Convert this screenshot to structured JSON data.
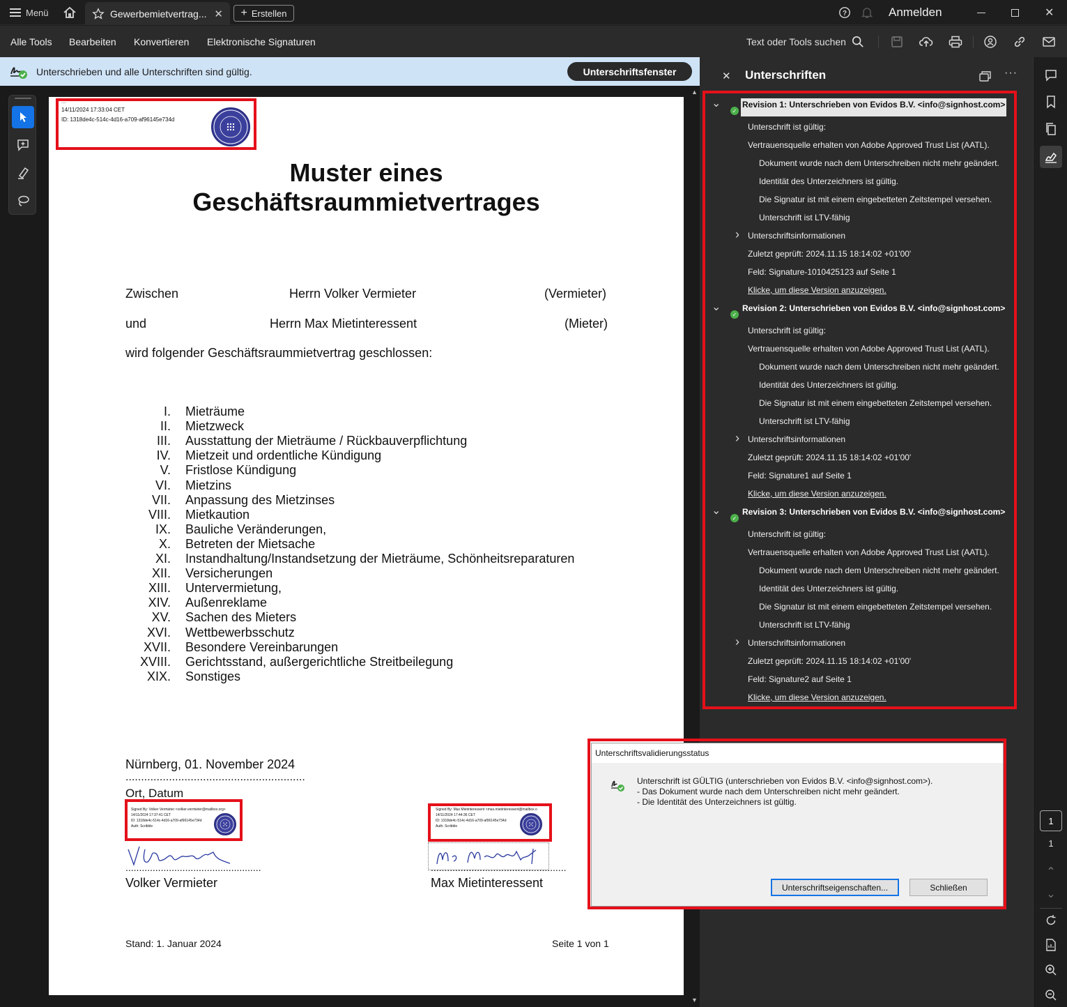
{
  "titlebar": {
    "menu_label": "Menü",
    "tab_title": "Gewerbemietvertrag...",
    "create_label": "Erstellen",
    "signin_label": "Anmelden"
  },
  "menubar": {
    "items": [
      "Alle Tools",
      "Bearbeiten",
      "Konvertieren",
      "Elektronische Signaturen"
    ],
    "search_label": "Text oder Tools suchen"
  },
  "notification": {
    "message": "Unterschrieben und alle Unterschriften sind gültig.",
    "button": "Unterschriftsfenster"
  },
  "document": {
    "top_stamp": {
      "line0": "...",
      "line1": "14/11/2024 17:33:04 CET",
      "line2": "ID: 1318de4c-514c-4d16-a709-af96145e734d"
    },
    "title_line1": "Muster eines",
    "title_line2": "Geschäftsraummietvertrages",
    "party1": {
      "label": "Zwischen",
      "name": "Herrn Volker Vermieter",
      "role": "(Vermieter)"
    },
    "party2": {
      "label": "und",
      "name": "Herrn Max Mietinteressent",
      "role": "(Mieter)"
    },
    "intro": "wird folgender Geschäftsraummietvertrag geschlossen:",
    "sections": [
      {
        "num": "I.",
        "text": "Mieträume"
      },
      {
        "num": "II.",
        "text": "Mietzweck"
      },
      {
        "num": "III.",
        "text": "Ausstattung der Mieträume / Rückbauverpflichtung"
      },
      {
        "num": "IV.",
        "text": "Mietzeit und ordentliche Kündigung"
      },
      {
        "num": "V.",
        "text": "Fristlose Kündigung"
      },
      {
        "num": "VI.",
        "text": "Mietzins"
      },
      {
        "num": "VII.",
        "text": "Anpassung des Mietzinses"
      },
      {
        "num": "VIII.",
        "text": "Mietkaution"
      },
      {
        "num": "IX.",
        "text": "Bauliche Veränderungen,"
      },
      {
        "num": "X.",
        "text": "Betreten der Mietsache"
      },
      {
        "num": "XI.",
        "text": "Instandhaltung/Instandsetzung der Mieträume, Schönheitsreparaturen"
      },
      {
        "num": "XII.",
        "text": "Versicherungen"
      },
      {
        "num": "XIII.",
        "text": "Untervermietung,"
      },
      {
        "num": "XIV.",
        "text": "Außenreklame"
      },
      {
        "num": "XV.",
        "text": "Sachen des Mieters"
      },
      {
        "num": "XVI.",
        "text": "Wettbewerbsschutz"
      },
      {
        "num": "XVII.",
        "text": "Besondere Vereinbarungen"
      },
      {
        "num": "XVIII.",
        "text": "Gerichtsstand, außergerichtliche Streitbeilegung"
      },
      {
        "num": "XIX.",
        "text": "Sonstiges"
      }
    ],
    "place_date": "Nürnberg, 01. November 2024",
    "dots": "..........................................................",
    "place_date_label": "Ort, Datum",
    "stamp_left": {
      "l1": "Signed By: Volker Vermieter <volker.vermieter@mailbox.org>",
      "l2": "14/11/2024 17:37:41 CET",
      "l3": "ID: 1318de4c-514c-4d16-a709-af96145e734d",
      "l4": "Auth: Scribble"
    },
    "stamp_right": {
      "l1": "Signed By: Max Mietinteressent <max.mietinteressent@mailbox.o",
      "l2": "14/11/2024 17:44:36 CET",
      "l3": "ID: 1318de4c-514c-4d16-a709-af96145e734d",
      "l4": "Auth: Scribble"
    },
    "sign_dots": "..................................................",
    "signer_left": "Volker Vermieter",
    "signer_right": "Max Mietinteressent",
    "footer_left": "Stand: 1. Januar 2024",
    "footer_right": "Seite 1 von 1",
    "seal_text": "SIGNHOST VERIFIED"
  },
  "signatures_panel": {
    "title": "Unterschriften",
    "revisions": [
      {
        "header": "Revision 1: Unterschrieben von Evidos B.V. <info@signhost.com>",
        "valid": "Unterschrift ist gültig:",
        "trust": "Vertrauensquelle erhalten von Adobe Approved Trust List (AATL).",
        "unchanged": "Dokument wurde nach dem Unterschreiben nicht mehr geändert.",
        "identity": "Identität des Unterzeichners ist gültig.",
        "timestamp": "Die Signatur ist mit einem eingebetteten Zeitstempel versehen.",
        "ltv": "Unterschrift ist LTV-fähig",
        "info": "Unterschriftsinformationen",
        "checked": "Zuletzt geprüft: 2024.11.15 18:14:02 +01'00'",
        "field": "Feld: Signature-1010425123 auf Seite 1",
        "link": "Klicke, um diese Version anzuzeigen."
      },
      {
        "header": "Revision 2: Unterschrieben von Evidos B.V. <info@signhost.com>",
        "valid": "Unterschrift ist gültig:",
        "trust": "Vertrauensquelle erhalten von Adobe Approved Trust List (AATL).",
        "unchanged": "Dokument wurde nach dem Unterschreiben nicht mehr geändert.",
        "identity": "Identität des Unterzeichners ist gültig.",
        "timestamp": "Die Signatur ist mit einem eingebetteten Zeitstempel versehen.",
        "ltv": "Unterschrift ist LTV-fähig",
        "info": "Unterschriftsinformationen",
        "checked": "Zuletzt geprüft: 2024.11.15 18:14:02 +01'00'",
        "field": "Feld: Signature1 auf Seite 1",
        "link": "Klicke, um diese Version anzuzeigen."
      },
      {
        "header": "Revision 3: Unterschrieben von Evidos B.V. <info@signhost.com>",
        "valid": "Unterschrift ist gültig:",
        "trust": "Vertrauensquelle erhalten von Adobe Approved Trust List (AATL).",
        "unchanged": "Dokument wurde nach dem Unterschreiben nicht mehr geändert.",
        "identity": "Identität des Unterzeichners ist gültig.",
        "timestamp": "Die Signatur ist mit einem eingebetteten Zeitstempel versehen.",
        "ltv": "Unterschrift ist LTV-fähig",
        "info": "Unterschriftsinformationen",
        "checked": "Zuletzt geprüft: 2024.11.15 18:14:02 +01'00'",
        "field": "Feld: Signature2 auf Seite 1",
        "link": "Klicke, um diese Version anzuzeigen."
      }
    ]
  },
  "page_nav": {
    "current": "1",
    "total": "1"
  },
  "dialog": {
    "title": "Unterschriftsvalidierungsstatus",
    "line1": "Unterschrift ist GÜLTIG (unterschrieben von Evidos B.V. <info@signhost.com>).",
    "line2": "- Das Dokument wurde nach dem Unterschreiben nicht mehr geändert.",
    "line3": "- Die Identität des Unterzeichners ist gültig.",
    "btn_props": "Unterschriftseigenschaften...",
    "btn_close": "Schließen"
  },
  "colors": {
    "accent": "#1473e6",
    "highlight": "#e4101a",
    "valid": "#4cb04a",
    "notification_bg": "#cfe3f7"
  }
}
